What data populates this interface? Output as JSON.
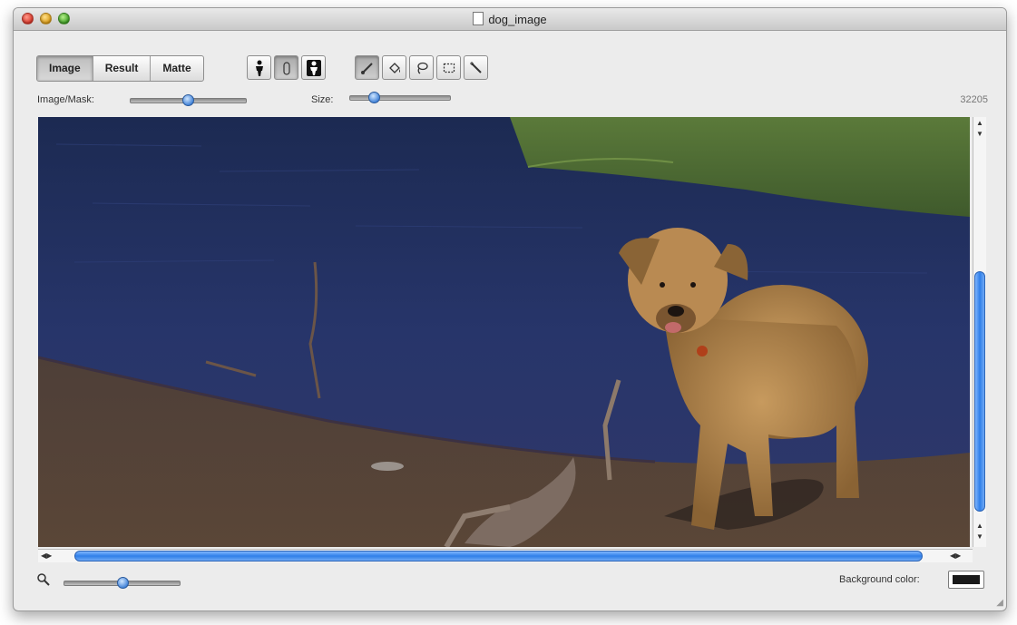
{
  "window": {
    "title": "dog_image"
  },
  "view_modes": [
    "Image",
    "Result",
    "Matte"
  ],
  "active_view": "Image",
  "tool_icons": [
    "person-solid-icon",
    "person-outline-icon",
    "person-inverted-icon"
  ],
  "brush_tools": [
    "brush-icon",
    "bucket-icon",
    "lasso-icon",
    "marquee-icon",
    "magic-wand-icon"
  ],
  "sliders": {
    "image_mask": {
      "label": "Image/Mask:",
      "value": 0.55
    },
    "size": {
      "label": "Size:",
      "value": 0.25
    },
    "zoom": {
      "value": 0.5
    }
  },
  "counter": "32205",
  "background_color": {
    "label": "Background color:",
    "value": "#1a1a1a"
  }
}
